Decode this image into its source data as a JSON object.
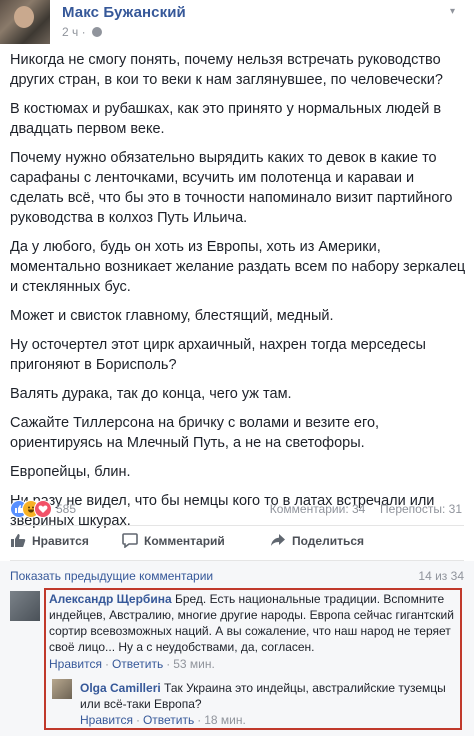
{
  "post": {
    "author": "Макс Бужанский",
    "time": "2 ч",
    "paragraphs": [
      "Никогда не смогу понять, почему нельзя встречать руководство других стран, в кои то веки к нам заглянувшее, по человечески?",
      "В костюмах и рубашках, как это принято у нормальных людей в двадцать первом веке.",
      "Почему нужно обязательно вырядить каких то девок в какие то сарафаны с ленточками, всучить им полотенца и караваи и сделать всё, что бы это в точности напоминало визит партийного руководства в колхоз Путь Ильича.",
      "Да у любого, будь он хоть из Европы, хоть из Америки, моментально возникает желание раздать всем по набору зеркалец и стеклянных бус.",
      "Может и свисток главному, блестящий, медный.",
      "Ну осточертел этот цирк архаичный, нахрен тогда мерседесы пригоняют в Борисполь?",
      "Валять дурака, так до конца, чего уж там.",
      "Сажайте Тиллерсона на бричку с волами и везите его, ориентируясь на Млечный Путь, а не на светофоры.",
      "Европейцы, блин.",
      "Ни разу не видел, что бы немцы кого то в латах встречали или звериных шкурах."
    ]
  },
  "reactions": {
    "count": "585",
    "comments_label": "Комментарии: 34",
    "shares_label": "Перепосты: 31"
  },
  "actions": {
    "like": "Нравится",
    "comment": "Комментарий",
    "share": "Поделиться"
  },
  "comments_section": {
    "show_previous": "Показать предыдущие комментарии",
    "counter": "14 из 34"
  },
  "comments": [
    {
      "author": "Александр Щербина",
      "text": "Бред. Есть национальные традиции. Вспомните индейцев, Австралию, многие другие народы. Европа сейчас гигантский сортир всевозможных наций. А вы сожаление, что наш народ не теряет своё лицо... Ну а с неудобствами, да, согласен.",
      "like": "Нравится",
      "reply": "Ответить",
      "time": "53 мин."
    },
    {
      "author": "Olga Camilleri",
      "text": "Так Украина это индейцы, австралийские туземцы или всё-таки Европа?",
      "like": "Нравится",
      "reply": "Ответить",
      "time": "18 мин."
    }
  ],
  "icons": {
    "globe": "globe-icon",
    "like_reaction": "like-reaction-icon",
    "haha_reaction": "haha-reaction-icon",
    "love_reaction": "love-reaction-icon",
    "thumb": "thumb-up-icon",
    "comment": "comment-bubble-icon",
    "share": "share-arrow-icon"
  },
  "colors": {
    "link": "#365899",
    "meta": "#90949c",
    "highlight": "#c0392b"
  }
}
